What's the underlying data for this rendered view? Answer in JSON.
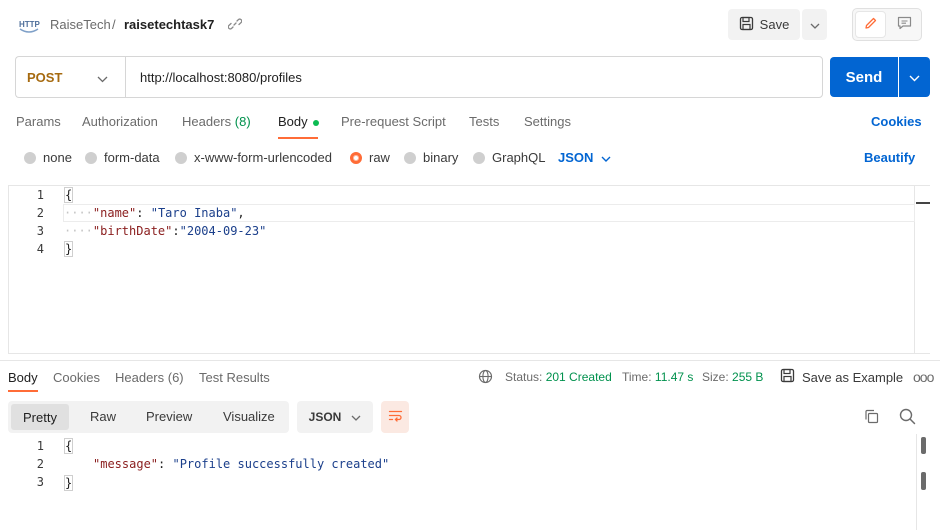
{
  "header": {
    "workspace": "RaiseTech",
    "separator": "/",
    "request_name": "raisetechtask7",
    "save_label": "Save"
  },
  "request": {
    "method": "POST",
    "url": "http://localhost:8080/profiles",
    "send_label": "Send"
  },
  "request_tabs": {
    "params": "Params",
    "authorization": "Authorization",
    "headers": "Headers",
    "headers_count": "(8)",
    "body": "Body",
    "prerequest": "Pre-request Script",
    "tests": "Tests",
    "settings": "Settings",
    "cookies": "Cookies"
  },
  "body_types": {
    "none": "none",
    "form_data": "form-data",
    "urlencoded": "x-www-form-urlencoded",
    "raw": "raw",
    "binary": "binary",
    "graphql": "GraphQL",
    "language": "JSON",
    "beautify": "Beautify"
  },
  "request_body": {
    "line_numbers": [
      "1",
      "2",
      "3",
      "4"
    ],
    "open": "{",
    "close": "}",
    "key1": "\"name\"",
    "colon1": ": ",
    "val1": "\"Taro Inaba\"",
    "comma1": ",",
    "key2": "\"birthDate\"",
    "colon2": ":",
    "val2": "\"2004-09-23\""
  },
  "response": {
    "tabs": {
      "body": "Body",
      "cookies": "Cookies",
      "headers": "Headers (6)",
      "test_results": "Test Results"
    },
    "status_label": "Status:",
    "status_value": "201 Created",
    "time_label": "Time:",
    "time_value": "11.47 s",
    "size_label": "Size:",
    "size_value": "255 B",
    "save_example": "Save as Example",
    "more": "ooo",
    "views": {
      "pretty": "Pretty",
      "raw": "Raw",
      "preview": "Preview",
      "visualize": "Visualize"
    },
    "format": "JSON",
    "body": {
      "line_numbers": [
        "1",
        "2",
        "3"
      ],
      "open": "{",
      "close": "}",
      "key": "\"message\"",
      "colon": ": ",
      "value": "\"Profile successfully created\""
    }
  },
  "colors": {
    "accent": "#ff6c37",
    "primary": "#0265d2",
    "success": "#00914d",
    "method_post": "#a66a0f"
  },
  "icons": [
    "http-icon",
    "link-icon",
    "save-icon",
    "chevron-down-icon",
    "pencil-icon",
    "comment-icon",
    "globe-icon",
    "copy-icon",
    "search-icon",
    "wrap-lines-icon"
  ]
}
